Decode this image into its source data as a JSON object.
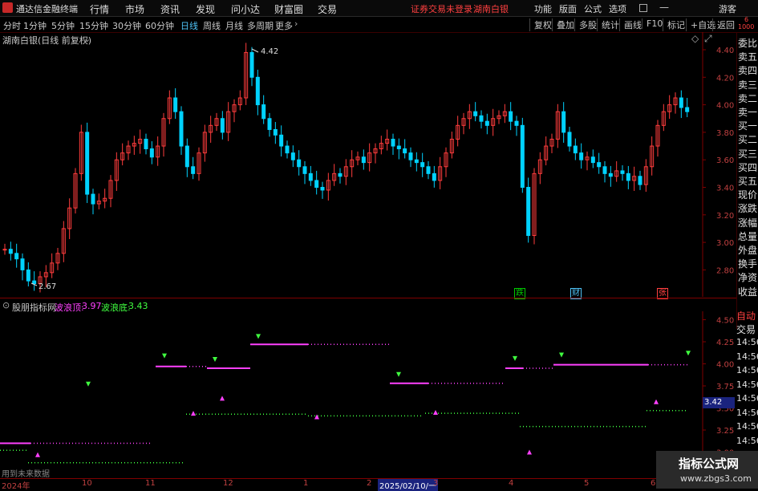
{
  "window": {
    "app_name": "通达信金融终端",
    "menus": [
      "行情",
      "市场",
      "资讯",
      "发现",
      "问小达",
      "财富圈",
      "交易"
    ],
    "warning": "证券交易未登录",
    "stock_name_title": "湖南白银",
    "right_menus": [
      "功能",
      "版面",
      "公式",
      "选项"
    ],
    "guest": "游客"
  },
  "toolbar": {
    "periods": [
      "分时",
      "1分钟",
      "5分钟",
      "15分钟",
      "30分钟",
      "60分钟",
      "日线",
      "周线",
      "月线",
      "多周期",
      "更多"
    ],
    "active_period": "日线",
    "right_buttons": [
      "复权",
      "叠加",
      "多股",
      "统计",
      "画线",
      "F10",
      "标记",
      "+自选",
      "返回"
    ]
  },
  "main_chart": {
    "header": "湖南白银(日线 前复权)",
    "high_label": "4.42",
    "low_label": "2.67",
    "y_ticks": [
      "4.40",
      "4.20",
      "4.00",
      "3.80",
      "3.60",
      "3.40",
      "3.20",
      "3.00",
      "2.80"
    ],
    "event_markers": [
      {
        "text": "跌",
        "color": "#00c800"
      },
      {
        "text": "财",
        "color": "#4fc3f7"
      },
      {
        "text": "张",
        "color": "#ff4040"
      }
    ],
    "colors": {
      "up": "#ff3c3c",
      "down": "#00d2ff",
      "bg": "#000000",
      "axis": "#800000"
    }
  },
  "indicator": {
    "name": "股朋指标网",
    "top_label": "波浪顶:",
    "top_value": "3.97",
    "bottom_label": "波浪底:",
    "bottom_value": "3.43",
    "y_ticks": [
      "4.50",
      "4.25",
      "4.00",
      "3.75",
      "3.50",
      "3.25",
      "3.00"
    ],
    "current_value": "3.42",
    "footer_note": "用到未来数据"
  },
  "x_axis": {
    "labels": [
      "2024年",
      "10",
      "11",
      "12",
      "1",
      "2",
      "2025/02/10/一",
      "3",
      "4",
      "5",
      "6"
    ]
  },
  "side_panel": {
    "items": [
      "委比",
      "卖五",
      "卖四",
      "卖三",
      "卖二",
      "卖一",
      "买一",
      "买二",
      "买三",
      "买四",
      "买五",
      "现价",
      "涨跌",
      "涨幅",
      "总量",
      "外盘",
      "换手",
      "净资",
      "收益"
    ],
    "lower_items": [
      "自动",
      "交易"
    ],
    "times": [
      "14:56",
      "14:56",
      "14:56",
      "14:56",
      "14:56",
      "14:56",
      "14:56",
      "14:56",
      "14:56"
    ],
    "top_small": [
      "6",
      "1000"
    ]
  },
  "watermark": {
    "line1": "指标公式网",
    "line2": "www.zbgs3.com"
  }
}
